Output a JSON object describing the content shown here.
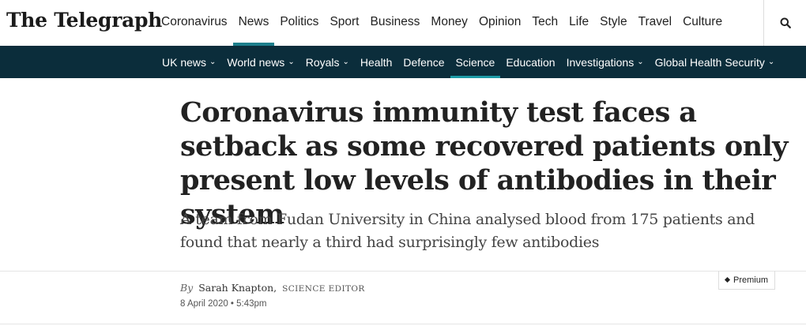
{
  "masthead": {
    "logo_text": "The Telegraph"
  },
  "main_nav": {
    "items": [
      {
        "label": "Coronavirus",
        "active": false
      },
      {
        "label": "News",
        "active": true
      },
      {
        "label": "Politics",
        "active": false
      },
      {
        "label": "Sport",
        "active": false
      },
      {
        "label": "Business",
        "active": false
      },
      {
        "label": "Money",
        "active": false
      },
      {
        "label": "Opinion",
        "active": false
      },
      {
        "label": "Tech",
        "active": false
      },
      {
        "label": "Life",
        "active": false
      },
      {
        "label": "Style",
        "active": false
      },
      {
        "label": "Travel",
        "active": false
      },
      {
        "label": "Culture",
        "active": false
      }
    ],
    "search_icon": "search-icon"
  },
  "sub_nav": {
    "items": [
      {
        "label": "UK news",
        "has_dropdown": true
      },
      {
        "label": "World news",
        "has_dropdown": true
      },
      {
        "label": "Royals",
        "has_dropdown": true
      },
      {
        "label": "Health",
        "has_dropdown": false
      },
      {
        "label": "Defence",
        "has_dropdown": false
      },
      {
        "label": "Science",
        "has_dropdown": false,
        "active": true
      },
      {
        "label": "Education",
        "has_dropdown": false
      },
      {
        "label": "Investigations",
        "has_dropdown": true
      },
      {
        "label": "Global Health Security",
        "has_dropdown": true
      }
    ],
    "dropdown_glyph": "⌄"
  },
  "article": {
    "headline": "Coronavirus immunity test faces a setback as some recovered patients only present low levels of antibodies in their system",
    "standfirst": "A team from Fudan University in China analysed blood from 175 patients and found that nearly a third had surprisingly few antibodies",
    "byline_prefix": "By",
    "author": "Sarah Knapton,",
    "author_role": "SCIENCE EDITOR",
    "date": "8 April 2020 • 5:43pm",
    "premium_label": "Premium"
  },
  "colors": {
    "subnav_bg": "#0b2d3b",
    "accent": "#1d7f8c",
    "text": "#222222"
  }
}
